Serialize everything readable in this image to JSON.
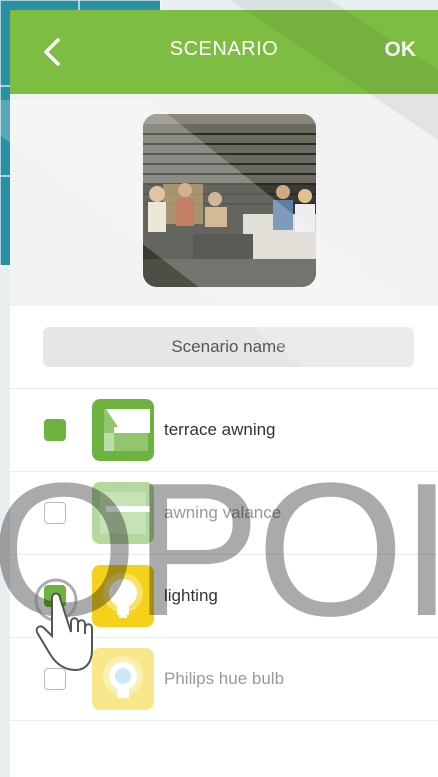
{
  "header": {
    "title": "SCENARIO",
    "ok_label": "OK"
  },
  "scenario": {
    "placeholder": "Scenario name"
  },
  "devices": [
    {
      "label": "terrace awning",
      "checked": true,
      "icon": "awning-icon"
    },
    {
      "label": "awning valance",
      "checked": false,
      "icon": "awning-valance-icon"
    },
    {
      "label": "lighting",
      "checked": true,
      "icon": "light-bulb-icon"
    },
    {
      "label": "Philips hue bulb",
      "checked": false,
      "icon": "hue-bulb-icon"
    }
  ],
  "watermark": {
    "text": "OPOI"
  },
  "colors": {
    "accent": "#7dbd42",
    "check": "#6cb33f",
    "light": "#f4d21a"
  }
}
